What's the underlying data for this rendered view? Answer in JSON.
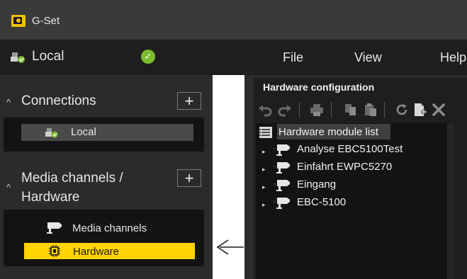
{
  "window": {
    "title": "G-Set"
  },
  "connection": {
    "name": "Local",
    "status_icon": "check-circle-icon",
    "status_color": "#7dbb2e"
  },
  "menu": [
    {
      "label": "File"
    },
    {
      "label": "View"
    },
    {
      "label": "Help"
    }
  ],
  "sidebar": {
    "connections": {
      "title": "Connections",
      "add_label": "+",
      "items": [
        {
          "label": "Local"
        }
      ]
    },
    "media": {
      "title_line1": "Media channels /",
      "title_line2": "Hardware",
      "add_label": "+",
      "items": [
        {
          "label": "Media channels",
          "icon": "camera-icon",
          "selected": false
        },
        {
          "label": "Hardware",
          "icon": "chip-icon",
          "selected": true
        }
      ]
    }
  },
  "hardware_config": {
    "title": "Hardware configuration",
    "toolbar": [
      "undo-icon",
      "redo-icon",
      "print-icon",
      "copy-icon",
      "paste-icon",
      "refresh-icon",
      "new-document-icon",
      "delete-icon"
    ],
    "tree": {
      "root_label": "Hardware module list",
      "items": [
        {
          "label": "Analyse EBC5100Test"
        },
        {
          "label": "Einfahrt EWPC5270"
        },
        {
          "label": "Eingang"
        },
        {
          "label": "EBC-5100"
        }
      ]
    }
  },
  "colors": {
    "accent": "#ffd400",
    "background": "#2b2b2b",
    "selected_text": "#1a1a1a"
  }
}
